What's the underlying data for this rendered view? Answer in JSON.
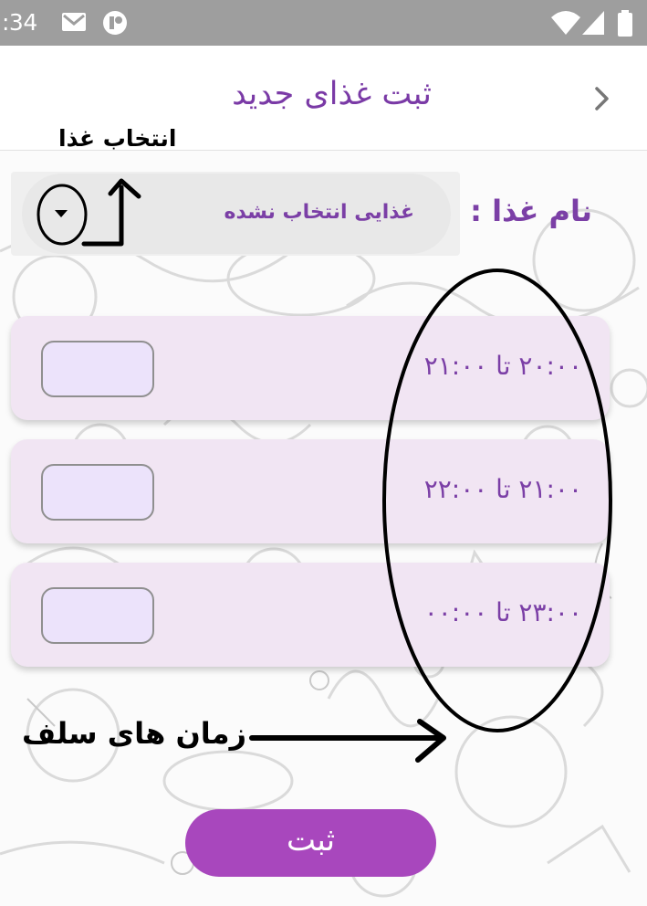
{
  "status_bar": {
    "time": ":34",
    "icons": [
      "gmail-icon",
      "app-notification-icon",
      "wifi-icon",
      "signal-icon",
      "battery-icon"
    ]
  },
  "app_bar": {
    "title": "ثبت غذای جدید",
    "back_icon": "chevron-right-icon"
  },
  "form": {
    "food_name_label": "نام غذا :",
    "food_dropdown_value": "غذایی انتخاب نشده",
    "dropdown_icon": "dropdown-arrow-icon",
    "time_slots": [
      {
        "label": "۲۰:۰۰ تا ۲۱:۰۰",
        "checked": false
      },
      {
        "label": "۲۱:۰۰ تا ۲۲:۰۰",
        "checked": false
      },
      {
        "label": "۲۳:۰۰ تا ۰۰:۰۰",
        "checked": false
      }
    ],
    "submit_label": "ثبت"
  },
  "annotations": {
    "select_food": "انتخاب غذا",
    "meal_times": "زمان های سلف"
  },
  "colors": {
    "status_bar": "#9e9e9e",
    "accent_purple": "#7b3fa6",
    "card_bg": "#f1e5f3",
    "checkbox_bg": "#ece3fb",
    "submit_bg": "#a847bd"
  }
}
